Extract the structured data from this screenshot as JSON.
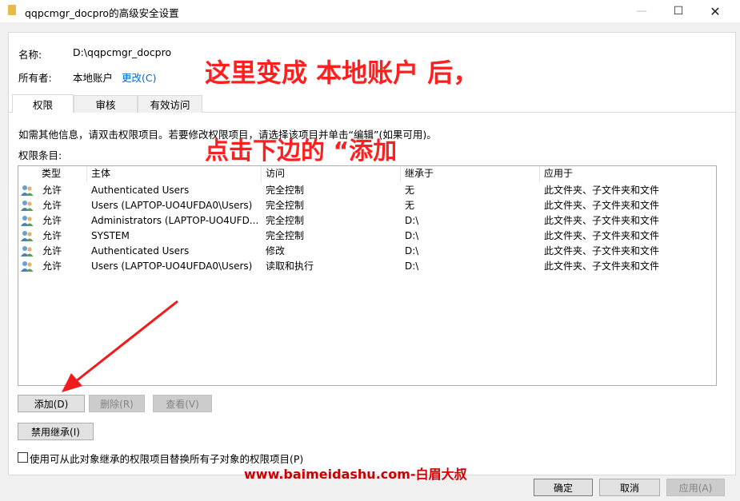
{
  "window": {
    "title": "qqpcmgr_docpro的高级安全设置",
    "min_glyph": "—",
    "max_glyph": "☐",
    "close_glyph": "✕"
  },
  "info": {
    "name_label": "名称:",
    "name_value": "D:\\qqpcmgr_docpro",
    "owner_label": "所有者:",
    "owner_value": "本地账户",
    "change_link": "更改(C)"
  },
  "tabs": [
    {
      "label": "权限",
      "active": true
    },
    {
      "label": "审核",
      "active": false
    },
    {
      "label": "有效访问",
      "active": false
    }
  ],
  "instructions": "如需其他信息，请双击权限项目。若要修改权限项目，请选择该项目并单击“编辑”(如果可用)。",
  "entries_label": "权限条目:",
  "columns": [
    "类型",
    "主体",
    "访问",
    "继承于",
    "应用于"
  ],
  "rows": [
    {
      "type": "允许",
      "principal": "Authenticated Users",
      "access": "完全控制",
      "inherited": "无",
      "applies": "此文件夹、子文件夹和文件"
    },
    {
      "type": "允许",
      "principal": "Users (LAPTOP-UO4UFDA0\\Users)",
      "access": "完全控制",
      "inherited": "无",
      "applies": "此文件夹、子文件夹和文件"
    },
    {
      "type": "允许",
      "principal": "Administrators (LAPTOP-UO4UFD...",
      "access": "完全控制",
      "inherited": "D:\\",
      "applies": "此文件夹、子文件夹和文件"
    },
    {
      "type": "允许",
      "principal": "SYSTEM",
      "access": "完全控制",
      "inherited": "D:\\",
      "applies": "此文件夹、子文件夹和文件"
    },
    {
      "type": "允许",
      "principal": "Authenticated Users",
      "access": "修改",
      "inherited": "D:\\",
      "applies": "此文件夹、子文件夹和文件"
    },
    {
      "type": "允许",
      "principal": "Users (LAPTOP-UO4UFDA0\\Users)",
      "access": "读取和执行",
      "inherited": "D:\\",
      "applies": "此文件夹、子文件夹和文件"
    }
  ],
  "buttons": {
    "add": "添加(D)",
    "remove": "删除(R)",
    "view": "查看(V)",
    "disable_inheritance": "禁用继承(I)",
    "ok": "确定",
    "cancel": "取消",
    "apply": "应用(A)"
  },
  "replace_checkbox_label": "使用可从此对象继承的权限项目替换所有子对象的权限项目(P)",
  "annotations": {
    "line1": "这里变成 本地账户 后，",
    "line2": "点击下边的 “添加",
    "color": "#ff1f1f"
  },
  "watermark": "www.baimeidashu.com-白眉大叔"
}
